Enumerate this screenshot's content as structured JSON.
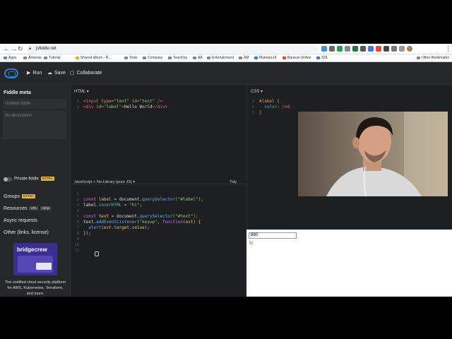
{
  "browser": {
    "url": "jsfiddle.net",
    "bookmarks": [
      "Apps",
      "Armenia",
      "Tutorial",
      "Shared album - R…",
      "Tools",
      "Company",
      "Teaching",
      "AA",
      "Entertainment",
      "AM",
      "Material-UI",
      "Bararan Online",
      "SDL",
      "Other Bookmarks"
    ]
  },
  "topbar": {
    "run": "Run",
    "save": "Save",
    "collaborate": "Collaborate"
  },
  "sidebar": {
    "title": "Fiddle meta",
    "title_placeholder": "Untitled fiddle",
    "desc_placeholder": "No description",
    "private": "Private fiddle",
    "extra": "EXTRA",
    "groups": "Groups",
    "resources": "Resources",
    "url_badge": "URL",
    "cdnjs_badge": "cdnjs",
    "async": "Async requests",
    "other": "Other (links, license)",
    "ad_brand": "bridgecrew",
    "ad_text": "The codified cloud security platform for AWS, Kubernetes, Terraform, and more."
  },
  "html_panel": {
    "label": "HTML ▾",
    "line1": {
      "open": "<input ",
      "a1": "type=",
      "v1": "\"text\"",
      "a2": " id=",
      "v2": "\"text\"",
      "close": " />"
    },
    "line2": {
      "open": "<div ",
      "a1": "id=",
      "v1": "\"label\"",
      "gt": ">",
      "text": "Hello World",
      "close": "</div>"
    }
  },
  "css_panel": {
    "label": "CSS ▾",
    "selector": "#label {",
    "prop": "color",
    "value": "red",
    "close": "}"
  },
  "js_panel": {
    "label": "JavaScript + No-Library (pure JS) ▾",
    "tidy": "Tidy",
    "l2": {
      "kw": "const ",
      "var": "label",
      "eq": " = ",
      "obj": "document",
      "dot": ".",
      "fn": "querySelector",
      "arg": "(\"#label\");"
    },
    "l3": {
      "obj": "label",
      "dot": ".",
      "prop": "innerHTML",
      "eq": " = ",
      "str": "\"hi\"",
      "end": ";"
    },
    "l5": {
      "kw": "const ",
      "var": "text",
      "eq": " = ",
      "obj": "document",
      "dot": ".",
      "fn": "querySelector",
      "arg": "(\"#text\");"
    },
    "l6": {
      "obj": "text",
      "dot": ".",
      "fn": "addEventListener",
      "open": "(",
      "str": "\"keyup\"",
      "comma": ", ",
      "kw": "function",
      "args": "(evt) {"
    },
    "l7": {
      "fn": "  alert",
      "arg": "(evt.target.value);"
    },
    "l8": "});"
  },
  "result": {
    "input_value": "890",
    "label_text": "hi"
  }
}
